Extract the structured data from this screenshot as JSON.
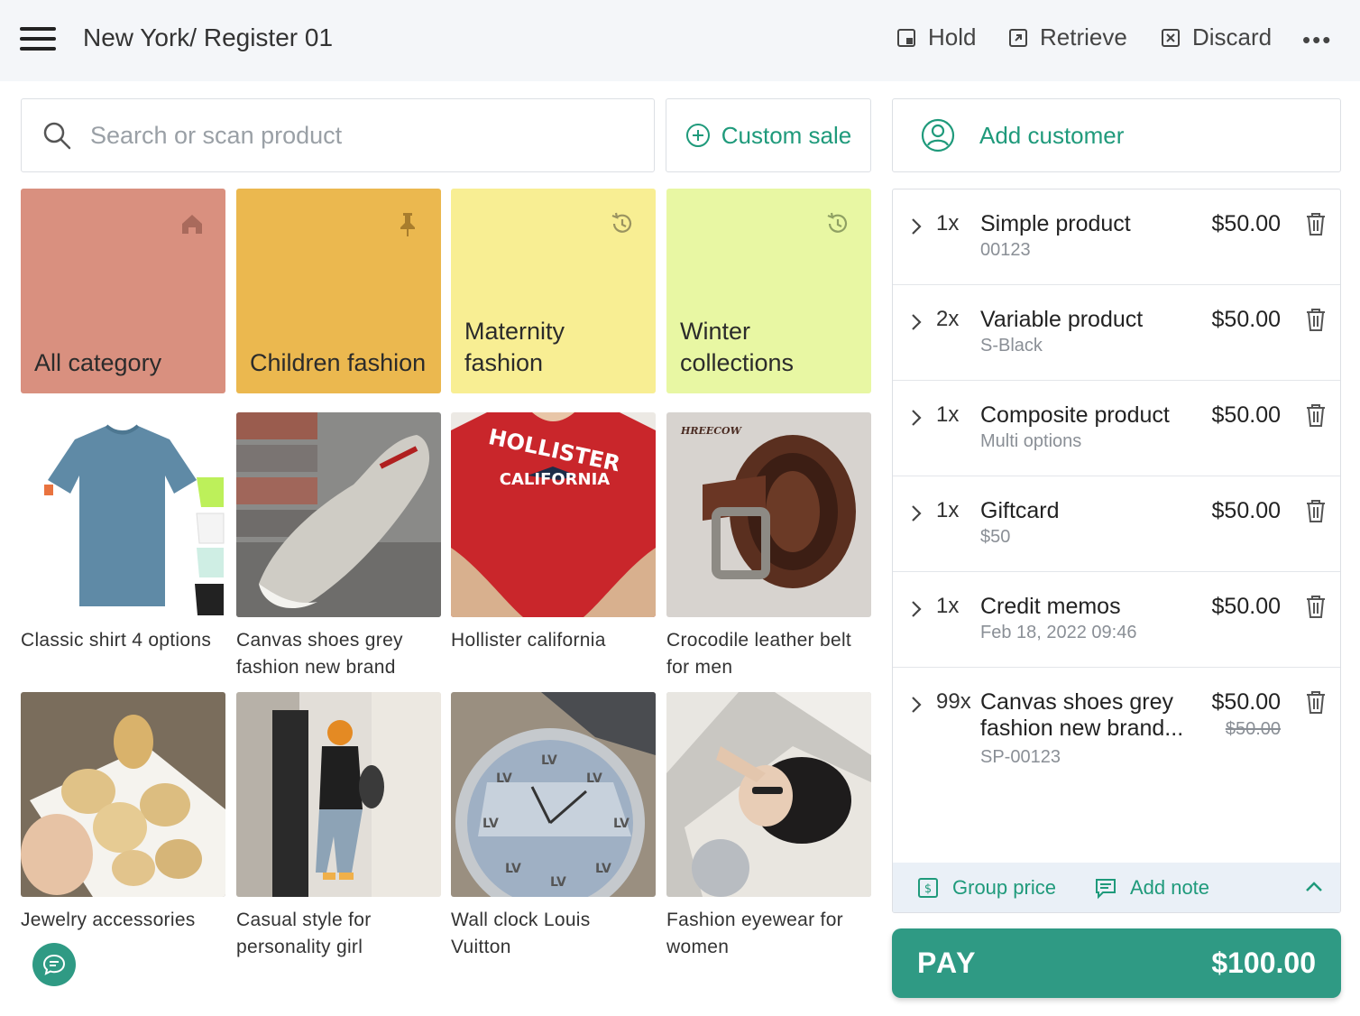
{
  "header": {
    "title": "New York/ Register 01",
    "actions": [
      {
        "label": "Hold",
        "icon": "hold-icon"
      },
      {
        "label": "Retrieve",
        "icon": "retrieve-icon"
      },
      {
        "label": "Discard",
        "icon": "discard-icon"
      }
    ],
    "more_icon": "more-icon"
  },
  "search": {
    "placeholder": "Search or scan product",
    "value": ""
  },
  "custom_sale": {
    "label": "Custom sale",
    "icon": "plus-circle-icon"
  },
  "customer": {
    "label": "Add customer",
    "icon": "user-circle-icon"
  },
  "categories": [
    {
      "label": "All category",
      "icon": "home-icon",
      "color": "#d9907f"
    },
    {
      "label": "Children fashion",
      "icon": "pin-icon",
      "color": "#ebb84f"
    },
    {
      "label": "Maternity fashion",
      "icon": "history-icon",
      "color": "#f8ee93"
    },
    {
      "label": "Winter collections",
      "icon": "history-icon",
      "color": "#e8f7a3"
    }
  ],
  "products": [
    {
      "name": "Classic shirt 4 options"
    },
    {
      "name": "Canvas shoes grey fashion new brand"
    },
    {
      "name": "Hollister california"
    },
    {
      "name": "Crocodile leather belt for men"
    },
    {
      "name": "Jewelry accessories"
    },
    {
      "name": "Casual style for personality girl"
    },
    {
      "name": "Wall clock Louis Vuitton"
    },
    {
      "name": "Fashion eyewear for women"
    }
  ],
  "product_image_text": {
    "shirt_brand": "HOLLISTER",
    "shirt_city": "CALIFORNIA",
    "belt_brand": "HREECOW"
  },
  "cart": {
    "items": [
      {
        "qty": "1x",
        "name": "Simple product",
        "sub": "00123",
        "price": "$50.00",
        "old_price": ""
      },
      {
        "qty": "2x",
        "name": "Variable product",
        "sub": "S-Black",
        "price": "$50.00",
        "old_price": ""
      },
      {
        "qty": "1x",
        "name": "Composite product",
        "sub": "Multi options",
        "price": "$50.00",
        "old_price": ""
      },
      {
        "qty": "1x",
        "name": "Giftcard",
        "sub": "$50",
        "price": "$50.00",
        "old_price": ""
      },
      {
        "qty": "1x",
        "name": "Credit memos",
        "sub": "Feb 18, 2022 09:46",
        "price": "$50.00",
        "old_price": ""
      },
      {
        "qty": "99x",
        "name": "Canvas shoes grey fashion new brand...",
        "sub": "SP-00123",
        "price": "$50.00",
        "old_price": "$50.00"
      }
    ],
    "group_price_label": "Group price",
    "add_note_label": "Add note"
  },
  "pay": {
    "label": "PAY",
    "total": "$100.00"
  },
  "colors": {
    "accent": "#1f9a7b",
    "pay": "#2f9a84"
  }
}
